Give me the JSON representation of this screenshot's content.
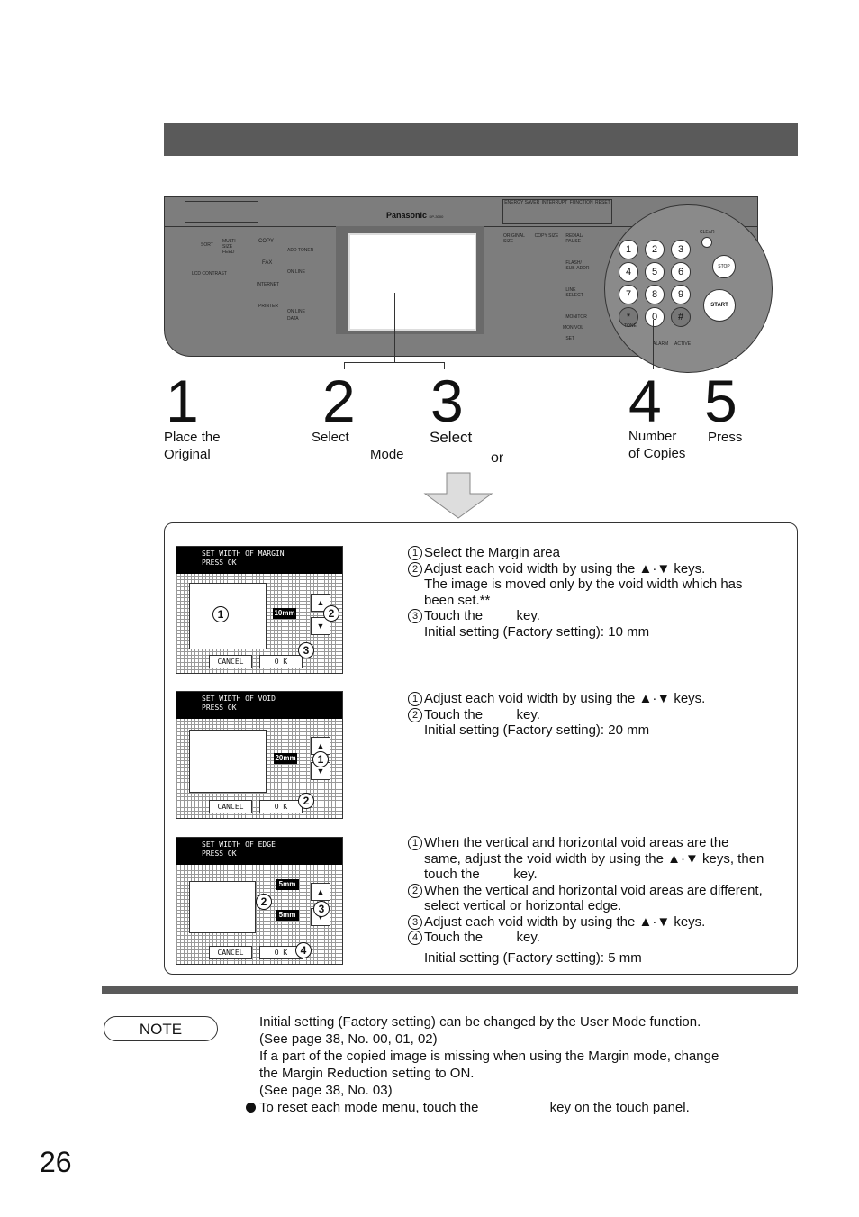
{
  "panel": {
    "brand": "Panasonic",
    "model": "DP-3000",
    "top_buttons": [
      "ENERGY SAVER",
      "INTERRUPT",
      "FUNCTION",
      "RESET"
    ],
    "left_labels": [
      "SORT",
      "MULTI-SIZE FEED",
      "LCD CONTRAST"
    ],
    "mode_buttons": [
      "COPY",
      "FAX",
      "INTERNET",
      "PRINTER"
    ],
    "indicators": [
      "ADD TONER",
      "ON LINE",
      "ON LINE",
      "DATA"
    ],
    "mid_labels": [
      "ORIGINAL SIZE",
      "COPY SIZE",
      "REDIAL/ PAUSE",
      "FLASH/ SUB-ADDR",
      "LINE SELECT",
      "MONITOR",
      "SET",
      "MON VOL"
    ],
    "keys": [
      "1",
      "2",
      "3",
      "4",
      "5",
      "6",
      "7",
      "8",
      "9",
      "*",
      "0",
      "#"
    ],
    "tone": "TONE",
    "clear": "CLEAR",
    "stop": "STOP",
    "start": "START",
    "alarm": "ALARM",
    "active": "ACTIVE"
  },
  "steps": [
    {
      "num": "1",
      "line1": "Place the",
      "line2": "Original"
    },
    {
      "num": "2",
      "line1": "Select",
      "line2": "Mode"
    },
    {
      "num": "3",
      "line1": "Select",
      "line2": "or"
    },
    {
      "num": "4",
      "line1": "Number",
      "line2": "of Copies"
    },
    {
      "num": "5",
      "line1": "Press",
      "line2": ""
    }
  ],
  "screens": [
    {
      "title1": "SET WIDTH OF MARGIN",
      "title2": "PRESS OK",
      "value": "10mm",
      "cancel": "CANCEL",
      "ok": "O K"
    },
    {
      "title1": "SET WIDTH OF VOID",
      "title2": "PRESS OK",
      "value": "20mm",
      "cancel": "CANCEL",
      "ok": "O K"
    },
    {
      "title1": "SET WIDTH OF EDGE",
      "title2": "PRESS OK",
      "value_v": "5mm",
      "value_h": "5mm",
      "cancel": "CANCEL",
      "ok": "O K"
    }
  ],
  "instructions": [
    [
      {
        "n": "1",
        "t": "Select the Margin area"
      },
      {
        "n": "2",
        "t": "Adjust each void width by using the ▲·▼ keys."
      },
      {
        "n": "",
        "t": "The image is moved only by the void width which has"
      },
      {
        "n": "",
        "t": "been set.**"
      },
      {
        "n": "3",
        "t": "Touch the         key."
      },
      {
        "n": "",
        "t": "Initial setting (Factory setting): 10 mm"
      }
    ],
    [
      {
        "n": "1",
        "t": "Adjust each void width by using the ▲·▼ keys."
      },
      {
        "n": "2",
        "t": "Touch the         key."
      },
      {
        "n": "",
        "t": "Initial setting (Factory setting): 20 mm"
      }
    ],
    [
      {
        "n": "1",
        "t": "When the vertical and horizontal void areas are the"
      },
      {
        "n": "",
        "t": "same, adjust the void width by using the ▲·▼ keys, then"
      },
      {
        "n": "",
        "t": "touch the         key."
      },
      {
        "n": "2",
        "t": "When the vertical and horizontal void areas are different,"
      },
      {
        "n": "",
        "t": "select vertical or horizontal edge."
      },
      {
        "n": "3",
        "t": "Adjust each void width by using the ▲·▼ keys."
      },
      {
        "n": "4",
        "t": "Touch the         key."
      },
      {
        "n": "",
        "t": ""
      },
      {
        "n": "",
        "t": "Initial setting (Factory setting): 5 mm"
      }
    ]
  ],
  "note": {
    "label": "NOTE",
    "lines": [
      "Initial setting (Factory setting) can be changed by the User Mode function.",
      "(See page 38, No. 00, 01, 02)",
      "If a part of the copied image is missing when using the Margin mode, change",
      "the Margin Reduction setting to ON.",
      "(See page 38, No. 03)"
    ],
    "bullet": "To reset each mode menu, touch the                   key on the touch panel."
  },
  "page_number": "26"
}
